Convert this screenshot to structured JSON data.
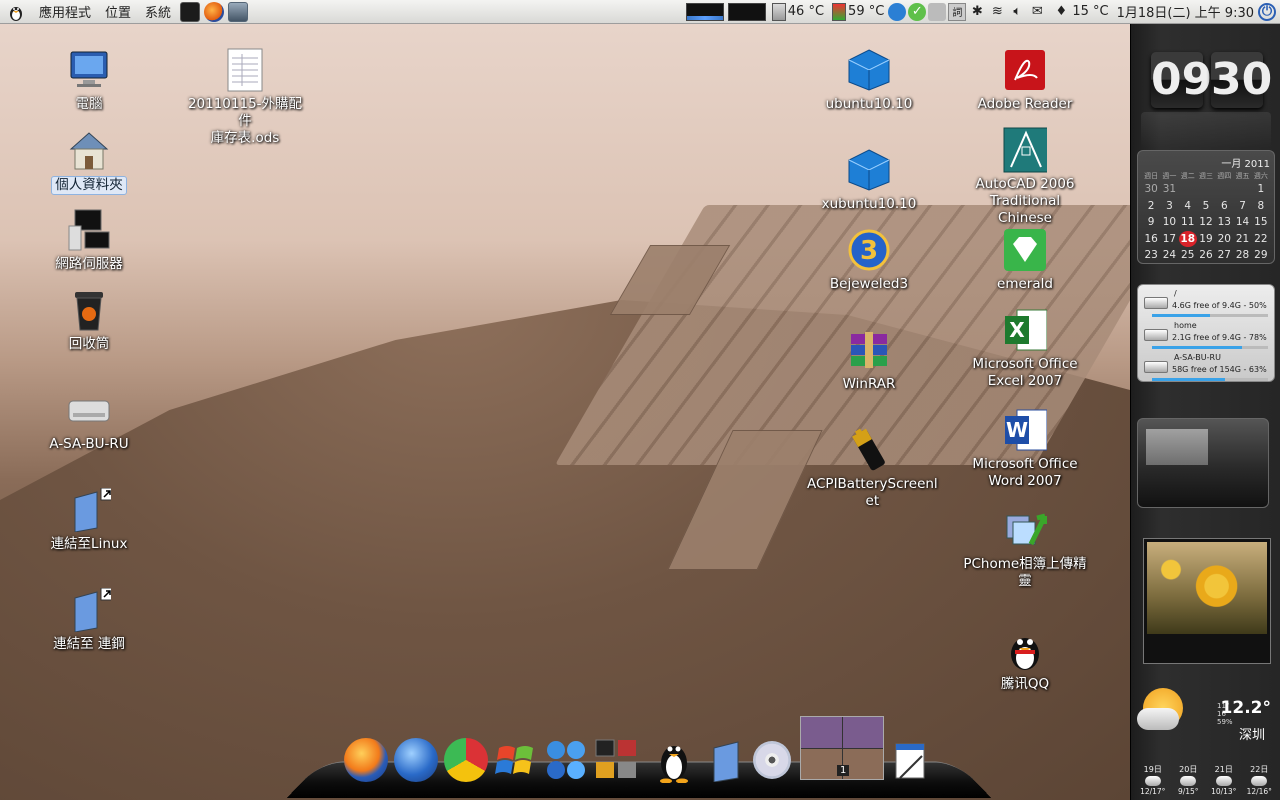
{
  "top_panel": {
    "menu": [
      "應用程式",
      "位置",
      "系統"
    ],
    "cpu_temp": "46 °C",
    "gpu_temp": "59 °C",
    "weather_temp": "15 °C",
    "datetime": "1月18日(二) 上午 9:30"
  },
  "desktop_left": [
    {
      "label": "電腦",
      "icon": "computer-icon"
    },
    {
      "label": "20110115-外購配件\n庫存表.ods",
      "icon": "spreadsheet-icon"
    },
    {
      "label": "個人資料夾",
      "icon": "home-folder-icon"
    },
    {
      "label": "網路伺服器",
      "icon": "network-server-icon"
    },
    {
      "label": "回收筒",
      "icon": "trash-icon"
    },
    {
      "label": "A-SA-BU-RU",
      "icon": "drive-icon"
    },
    {
      "label": "連結至Linux",
      "icon": "link-folder-icon"
    },
    {
      "label": "連結至 連鋼",
      "icon": "link-folder-icon"
    }
  ],
  "desktop_right": [
    {
      "label": "ubuntu10.10",
      "icon": "virtualbox-icon"
    },
    {
      "label": "Adobe Reader",
      "icon": "adobe-reader-icon"
    },
    {
      "label": "AutoCAD 2006\nTraditional Chinese",
      "icon": "autocad-icon"
    },
    {
      "label": "xubuntu10.10",
      "icon": "virtualbox-icon"
    },
    {
      "label": "Bejeweled3",
      "icon": "bejeweled-icon"
    },
    {
      "label": "emerald",
      "icon": "emerald-icon"
    },
    {
      "label": "WinRAR",
      "icon": "winrar-icon"
    },
    {
      "label": "Microsoft Office\nExcel 2007",
      "icon": "excel-icon"
    },
    {
      "label": "ACPIBatteryScreenl\net",
      "icon": "battery-icon"
    },
    {
      "label": "Microsoft Office\nWord 2007",
      "icon": "word-icon"
    },
    {
      "label": "PChome相簿上傳精\n靈",
      "icon": "photo-upload-icon"
    },
    {
      "label": "騰讯QQ",
      "icon": "qq-penguin-icon"
    }
  ],
  "clock": {
    "hours": "09",
    "minutes": "30"
  },
  "calendar": {
    "month_label": "一月 2011",
    "weekdays": [
      "週日",
      "週一",
      "週二",
      "週三",
      "週四",
      "週五",
      "週六"
    ],
    "rows": [
      [
        "30",
        "31",
        "",
        "",
        "",
        "",
        "1"
      ],
      [
        "2",
        "3",
        "4",
        "5",
        "6",
        "7",
        "8"
      ],
      [
        "9",
        "10",
        "11",
        "12",
        "13",
        "14",
        "15"
      ],
      [
        "16",
        "17",
        "18",
        "19",
        "20",
        "21",
        "22"
      ],
      [
        "23",
        "24",
        "25",
        "26",
        "27",
        "28",
        "29"
      ]
    ],
    "today": "18"
  },
  "drives": [
    {
      "name": "/",
      "info": "4.6G free of 9.4G - 50%",
      "used": 0.5
    },
    {
      "name": "home",
      "info": "2.1G free of 9.4G - 78%",
      "used": 0.78
    },
    {
      "name": "A-SA-BU-RU",
      "info": "58G free of 154G - 63%",
      "used": 0.63
    }
  ],
  "weather": {
    "temp": "12.2°",
    "city": "深圳",
    "small": [
      "11°",
      "16°",
      "59%"
    ],
    "forecast": [
      {
        "day": "19日",
        "range": "12/17°"
      },
      {
        "day": "20日",
        "range": "9/15°"
      },
      {
        "day": "21日",
        "range": "10/13°"
      },
      {
        "day": "22日",
        "range": "12/16°"
      }
    ]
  },
  "dock": {
    "workspace_number": "1",
    "items": [
      "firefox-icon",
      "thunderbird-icon",
      "chrome-icon",
      "windows-icon",
      "stacks-icon",
      "terminal-stack-icon",
      "tux-icon",
      "folder-icon",
      "cd-icon",
      "workspace-switcher",
      "editor-icon"
    ]
  },
  "colors": {
    "accent_blue": "#3aa2e8",
    "today_red": "#d9232a"
  }
}
